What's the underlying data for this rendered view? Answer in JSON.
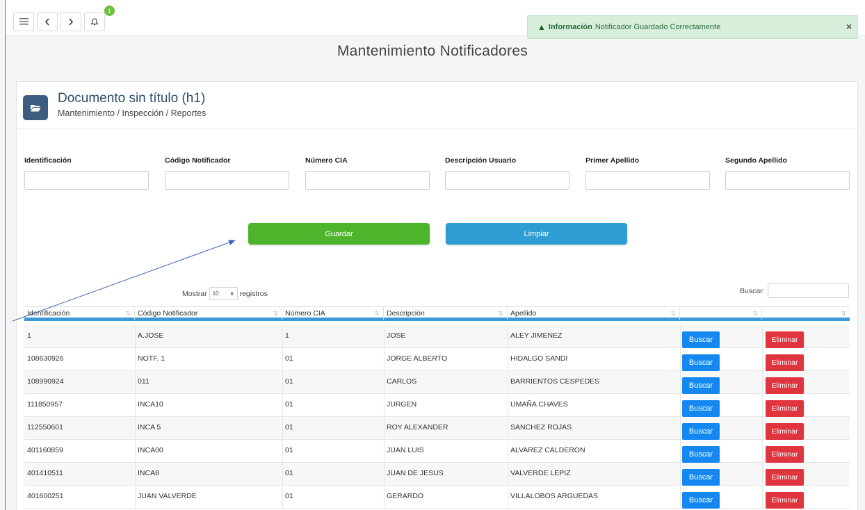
{
  "topbar": {
    "menu_icon": "hamburger-icon",
    "back_icon": "chevron-left-icon",
    "forward_icon": "chevron-right-icon",
    "bell_icon": "bell-icon",
    "notification_count": "1"
  },
  "alert": {
    "icon": "warning-icon",
    "label": "Información",
    "message": "Notificador Guardado Correctamente",
    "close": "×",
    "color": "#d7eedb"
  },
  "page": {
    "title": "Mantenimiento Notificadores"
  },
  "card": {
    "icon": "folder-open-icon",
    "title": "Documento sin título (h1)",
    "breadcrumb": "Mantenimiento / Inspección / Reportes"
  },
  "form": {
    "fields": [
      {
        "label": "Identificación",
        "value": ""
      },
      {
        "label": "Código Notificador",
        "value": ""
      },
      {
        "label": "Número CIA",
        "value": ""
      },
      {
        "label": "Descripción Usuario",
        "value": ""
      },
      {
        "label": "Primer Apellido",
        "value": ""
      },
      {
        "label": "Segundo Apellido",
        "value": ""
      }
    ],
    "save_label": "Guardar",
    "clear_label": "Limpiar"
  },
  "table_controls": {
    "show_prefix": "Mostrar",
    "page_size": "10",
    "show_suffix": "registros",
    "search_label": "Buscar:",
    "search_value": ""
  },
  "table": {
    "columns": [
      "Identificación",
      "Código Notificador",
      "Número CIA",
      "Descripción",
      "Apellido",
      "",
      ""
    ],
    "search_button": "Buscar",
    "delete_button": "Eliminar",
    "rows": [
      {
        "id": "1",
        "code": "A.JOSE",
        "cia": "1",
        "desc": "JOSE",
        "surname": "ALEY JIMENEZ"
      },
      {
        "id": "108630926",
        "code": "NOTF. 1",
        "cia": "01",
        "desc": "JORGE ALBERTO",
        "surname": "HIDALGO SANDI"
      },
      {
        "id": "108990924",
        "code": "011",
        "cia": "01",
        "desc": "CARLOS",
        "surname": "BARRIENTOS CESPEDES"
      },
      {
        "id": "111850957",
        "code": "INCA10",
        "cia": "01",
        "desc": "JURGEN",
        "surname": "UMAÑA CHAVES"
      },
      {
        "id": "112550601",
        "code": "INCA 5",
        "cia": "01",
        "desc": "ROY ALEXANDER",
        "surname": "SANCHEZ ROJAS"
      },
      {
        "id": "401160859",
        "code": "INCA00",
        "cia": "01",
        "desc": "JUAN LUIS",
        "surname": "ALVAREZ CALDERON"
      },
      {
        "id": "401410511",
        "code": "INCA8",
        "cia": "01",
        "desc": "JUAN DE JESUS",
        "surname": "VALVERDE LEPIZ"
      },
      {
        "id": "401600251",
        "code": "JUAN VALVERDE",
        "cia": "01",
        "desc": "GERARDO",
        "surname": "VILLALOBOS ARGUEDAS"
      }
    ]
  },
  "colors": {
    "save": "#4db52c",
    "clear": "#2e9dd3",
    "search_btn": "#1488f0",
    "delete_btn": "#e0343f",
    "header_rule": "#3a99d6"
  }
}
